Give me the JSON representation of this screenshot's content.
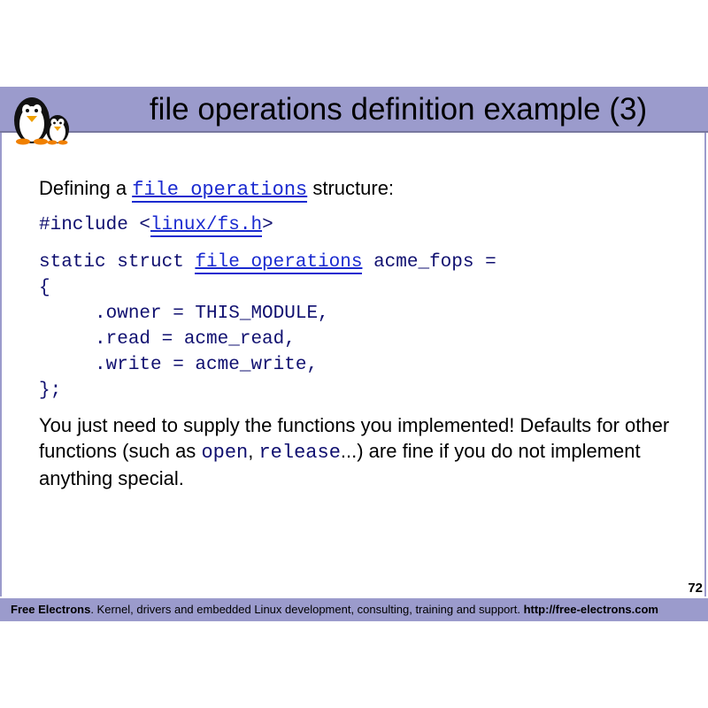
{
  "title": "file operations definition example (3)",
  "intro": {
    "before": "Defining a ",
    "link": "file_operations",
    "after": " structure:"
  },
  "include_line": {
    "before": "#include <",
    "link": "linux/fs.h",
    "after": ">"
  },
  "struct_line": {
    "before": "static struct ",
    "link": "file_operations",
    "after": " acme_fops ="
  },
  "code_lines": [
    "{",
    "     .owner = THIS_MODULE,",
    "     .read = acme_read,",
    "     .write = acme_write,",
    "};"
  ],
  "outro": {
    "part1": "You just need to supply the functions you implemented! Defaults for other functions (such as ",
    "code1": "open",
    "sep": ", ",
    "code2": "release",
    "part2": "...) are fine if you do not implement anything special."
  },
  "page_number": "72",
  "footer": {
    "brand": "Free Electrons",
    "text": ". Kernel, drivers and embedded Linux development, consulting, training and support. ",
    "url": "http://free-electrons.com"
  }
}
